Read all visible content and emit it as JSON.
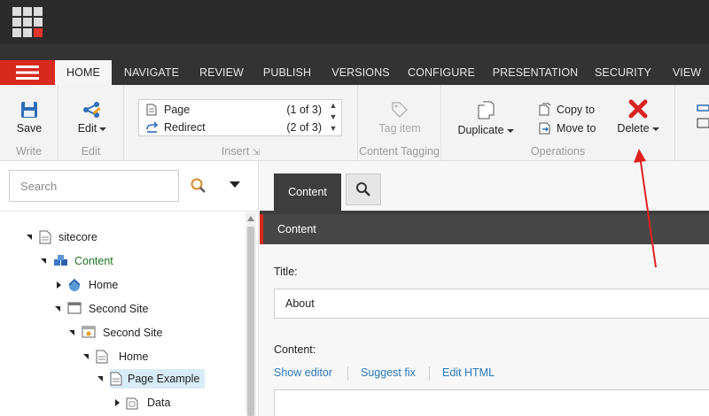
{
  "colors": {
    "accent_red": "#d9281d",
    "topbar": "#2b2b2b",
    "tabbar": "#333333",
    "link": "#2a78b8",
    "tree_green": "#207520",
    "annotation_arrow": "#e02020"
  },
  "tabs": [
    {
      "label": "HOME",
      "active": true
    },
    {
      "label": "NAVIGATE"
    },
    {
      "label": "REVIEW"
    },
    {
      "label": "PUBLISH"
    },
    {
      "label": "VERSIONS"
    },
    {
      "label": "CONFIGURE"
    },
    {
      "label": "PRESENTATION"
    },
    {
      "label": "SECURITY"
    },
    {
      "label": "VIEW"
    }
  ],
  "ribbon": {
    "save_label": "Save",
    "write_group": "Write",
    "edit_label": "Edit",
    "edit_group": "Edit",
    "insert_items": [
      {
        "label": "Page",
        "count": "(1 of 3)"
      },
      {
        "label": "Redirect",
        "count": "(2 of 3)"
      }
    ],
    "insert_group": "Insert",
    "tag_item_label": "Tag item",
    "tagging_group": "Content Tagging",
    "duplicate_label": "Duplicate",
    "copy_to_label": "Copy to",
    "move_to_label": "Move to",
    "delete_label": "Delete",
    "operations_group": "Operations"
  },
  "search": {
    "placeholder": "Search"
  },
  "tree": [
    {
      "label": "sitecore",
      "icon": "page-icon",
      "state": "open"
    },
    {
      "label": "Content",
      "icon": "content-cube-icon",
      "state": "open"
    },
    {
      "label": "Home",
      "icon": "home-globe-icon",
      "state": "closed"
    },
    {
      "label": "Second Site",
      "icon": "window-icon",
      "state": "open"
    },
    {
      "label": "Second Site",
      "icon": "site-star-icon",
      "state": "open"
    },
    {
      "label": "Home",
      "icon": "page-icon",
      "state": "open"
    },
    {
      "label": "Page Example",
      "icon": "page-icon",
      "state": "open",
      "selected": true
    },
    {
      "label": "Data",
      "icon": "data-folder-icon",
      "state": "closed"
    }
  ],
  "editor": {
    "content_tab": "Content",
    "section_title": "Content",
    "title_label": "Title:",
    "title_value": "About",
    "content_label": "Content:",
    "links": [
      "Show editor",
      "Suggest fix",
      "Edit HTML"
    ]
  }
}
